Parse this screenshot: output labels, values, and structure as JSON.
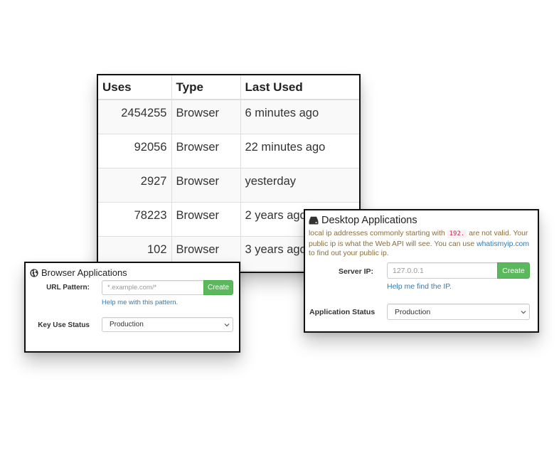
{
  "usage_table": {
    "headers": [
      "Uses",
      "Type",
      "Last Used"
    ],
    "rows": [
      {
        "uses": "2454255",
        "type": "Browser",
        "last_used": "6 minutes ago"
      },
      {
        "uses": "92056",
        "type": "Browser",
        "last_used": "22 minutes ago"
      },
      {
        "uses": "2927",
        "type": "Browser",
        "last_used": "yesterday"
      },
      {
        "uses": "78223",
        "type": "Browser",
        "last_used": "2 years ago"
      },
      {
        "uses": "102",
        "type": "Browser",
        "last_used": "3 years ago"
      }
    ]
  },
  "browser_apps": {
    "title": "Browser Applications",
    "icon": "globe-icon",
    "url_pattern_label": "URL Pattern:",
    "url_pattern_placeholder": "*.example.com/*",
    "create_label": "Create",
    "help_link": "Help me with this pattern.",
    "status_label": "Key Use Status",
    "status_value": "Production"
  },
  "desktop_apps": {
    "title": "Desktop Applications",
    "icon": "hdd-icon",
    "warning_part1": "local ip addresses commonly starting with",
    "warning_code": "192.",
    "warning_part2": "are not valid. Your public ip is what the Web API will see. You can use",
    "warning_link": "whatismyip.com",
    "warning_part3": "to find out your public ip.",
    "server_ip_label": "Server IP:",
    "server_ip_placeholder": "127.0.0.1",
    "create_label": "Create",
    "help_link": "Help me find the IP.",
    "status_label": "Application Status",
    "status_value": "Production"
  },
  "colors": {
    "create_button": "#5cb85c",
    "link": "#337ab7",
    "warning_text": "#8a6d3b",
    "code_text": "#c7254e",
    "panel_border": "#111111"
  }
}
